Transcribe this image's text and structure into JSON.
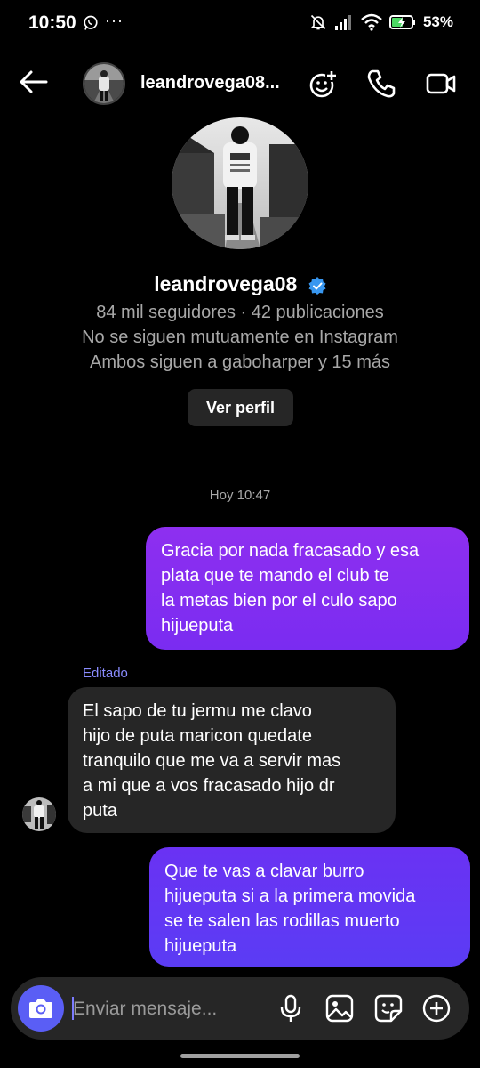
{
  "status_bar": {
    "time": "10:50",
    "more": "···",
    "battery": "53%",
    "icons": [
      "whatsapp-icon",
      "mute-icon",
      "signal-icon",
      "wifi-icon",
      "battery-charging-icon"
    ]
  },
  "header": {
    "username": "leandrovega08...",
    "icons": [
      "back-arrow-icon",
      "add-effect-icon",
      "phone-icon",
      "video-icon"
    ]
  },
  "profile": {
    "name": "leandrovega08",
    "followers_line": "84 mil seguidores · 42 publicaciones",
    "mutual_line": "No se siguen mutuamente en Instagram",
    "both_follow_line": "Ambos siguen a gaboharper y 15 más",
    "view_profile_label": "Ver perfil"
  },
  "chat": {
    "timestamp": "Hoy 10:47",
    "edited_label": "Editado",
    "messages": [
      {
        "direction": "out",
        "text": "Gracia por nada fracasado y esa\nplata que te mando el club te\nla metas bien por el culo sapo\nhijueputa"
      },
      {
        "direction": "in",
        "text": "El sapo de tu jermu me clavo\nhijo de puta maricon quedate\ntranquilo que me va a servir mas\na mi que a vos fracasado hijo dr\nputa"
      },
      {
        "direction": "out",
        "text": "Que te vas a clavar burro\nhijueputa si a la primera movida\nse te salen las rodillas muerto\nhijueputa"
      }
    ]
  },
  "composer": {
    "placeholder": "Enviar mensaje...",
    "icons": [
      "camera-icon",
      "microphone-icon",
      "gallery-icon",
      "sticker-icon",
      "add-icon"
    ]
  },
  "colors": {
    "background": "#000000",
    "outgoing_bubble": "#8e2ff0",
    "outgoing_bubble_2": "#6a32f3",
    "incoming_bubble": "#262626",
    "camera_button": "#5a5ef5",
    "verified": "#3897f0",
    "edited": "#8a8cff"
  }
}
